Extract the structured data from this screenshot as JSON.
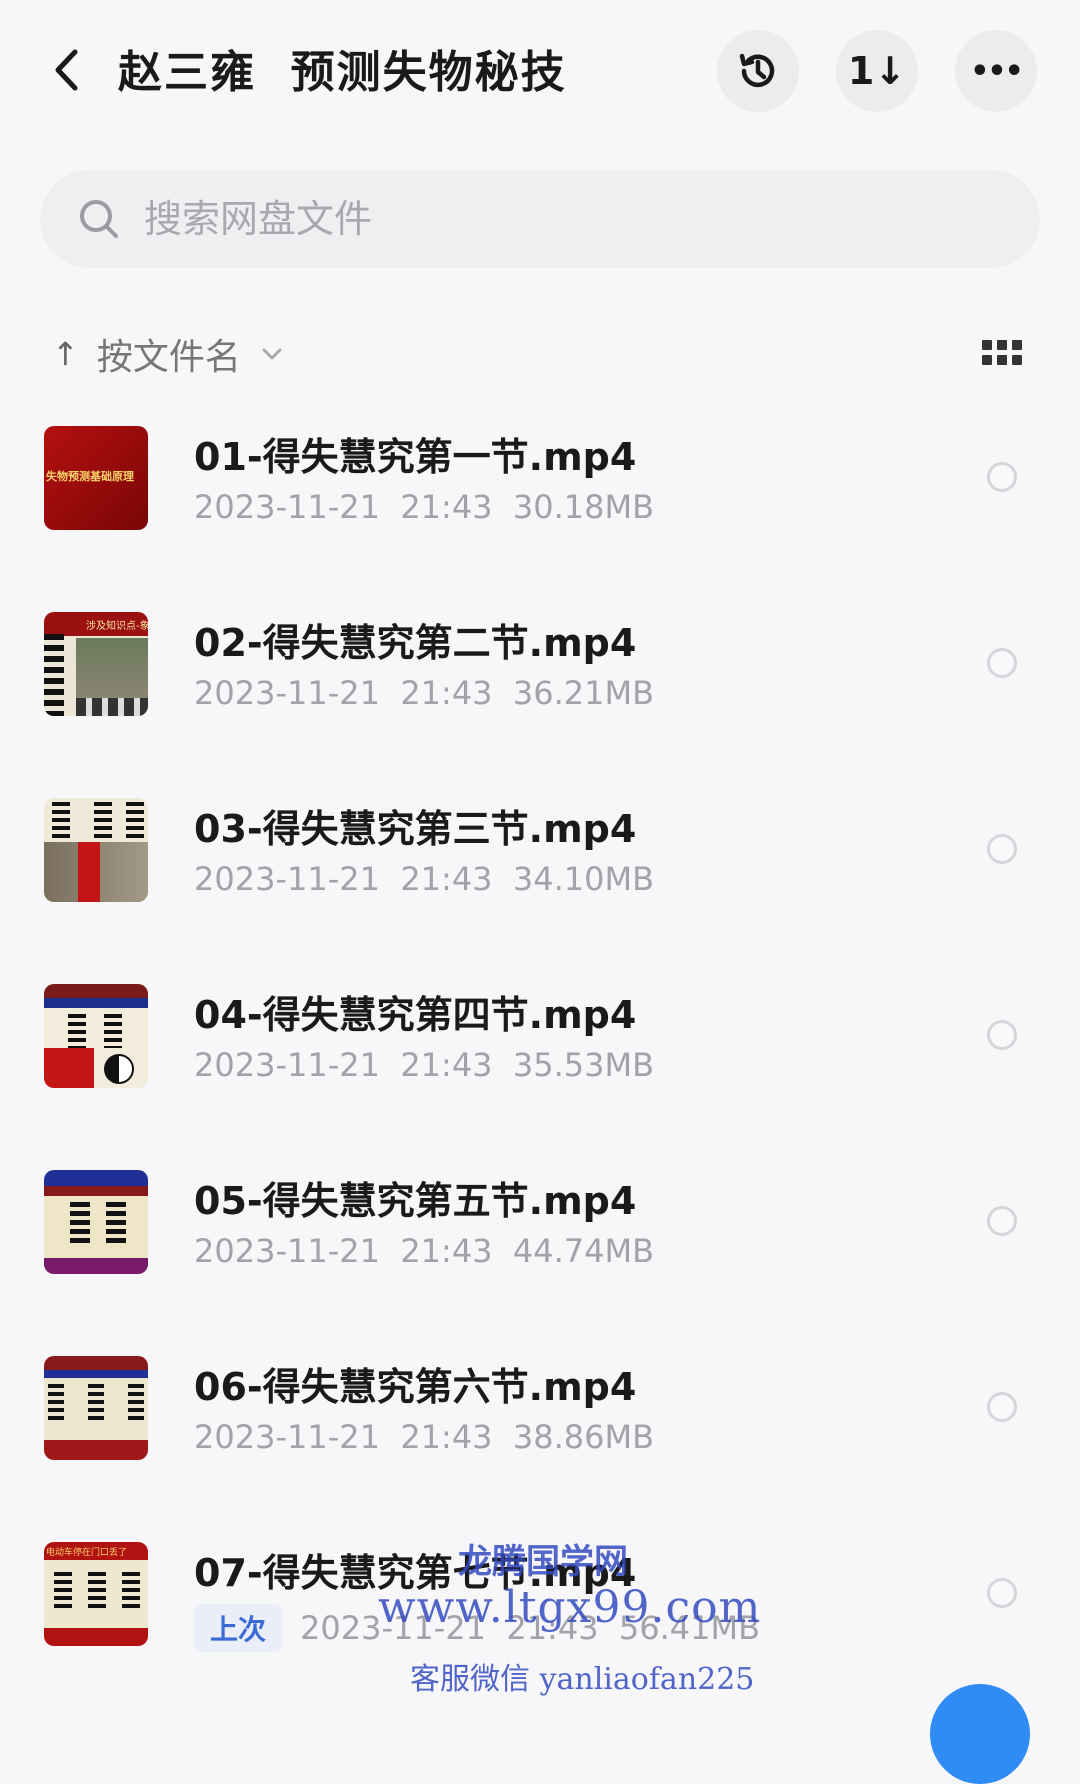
{
  "header": {
    "title": "赵三雍  预测失物秘技",
    "back_icon": "chevron-left-icon",
    "history_icon": "history-icon",
    "sort_icon": "sort-arrows-icon",
    "more_icon": "more-dots-icon",
    "sort_glyph": "1↓",
    "more_glyph": "•••"
  },
  "search": {
    "placeholder": "搜索网盘文件"
  },
  "sortbar": {
    "arrow": "↑",
    "label": "按文件名"
  },
  "files": [
    {
      "name": "01-得失慧究第一节.mp4",
      "date": "2023-11-21",
      "time": "21:43",
      "size": "30.18MB",
      "thumb_label": "失物预测基础原理"
    },
    {
      "name": "02-得失慧究第二节.mp4",
      "date": "2023-11-21",
      "time": "21:43",
      "size": "36.21MB",
      "thumb_label": "涉及知识点-象"
    },
    {
      "name": "03-得失慧究第三节.mp4",
      "date": "2023-11-21",
      "time": "21:43",
      "size": "34.10MB",
      "thumb_label": ""
    },
    {
      "name": "04-得失慧究第四节.mp4",
      "date": "2023-11-21",
      "time": "21:43",
      "size": "35.53MB",
      "thumb_label": ""
    },
    {
      "name": "05-得失慧究第五节.mp4",
      "date": "2023-11-21",
      "time": "21:43",
      "size": "44.74MB",
      "thumb_label": ""
    },
    {
      "name": "06-得失慧究第六节.mp4",
      "date": "2023-11-21",
      "time": "21:43",
      "size": "38.86MB",
      "thumb_label": ""
    },
    {
      "name": "07-得失慧究第七节.mp4",
      "date": "2023-11-21",
      "time": "21:43",
      "size": "56.41MB",
      "thumb_label": "电动车停在门口丢了",
      "tag": "上次"
    }
  ],
  "watermark": {
    "line1": "龙腾国学网",
    "line2": "www.ltgx99.com",
    "line3": "客服微信 yanliaofan225"
  },
  "colors": {
    "background": "#f7f7f9",
    "accent": "#2f8cf4",
    "tag_text": "#3a6bd4",
    "watermark": "#344abe"
  }
}
